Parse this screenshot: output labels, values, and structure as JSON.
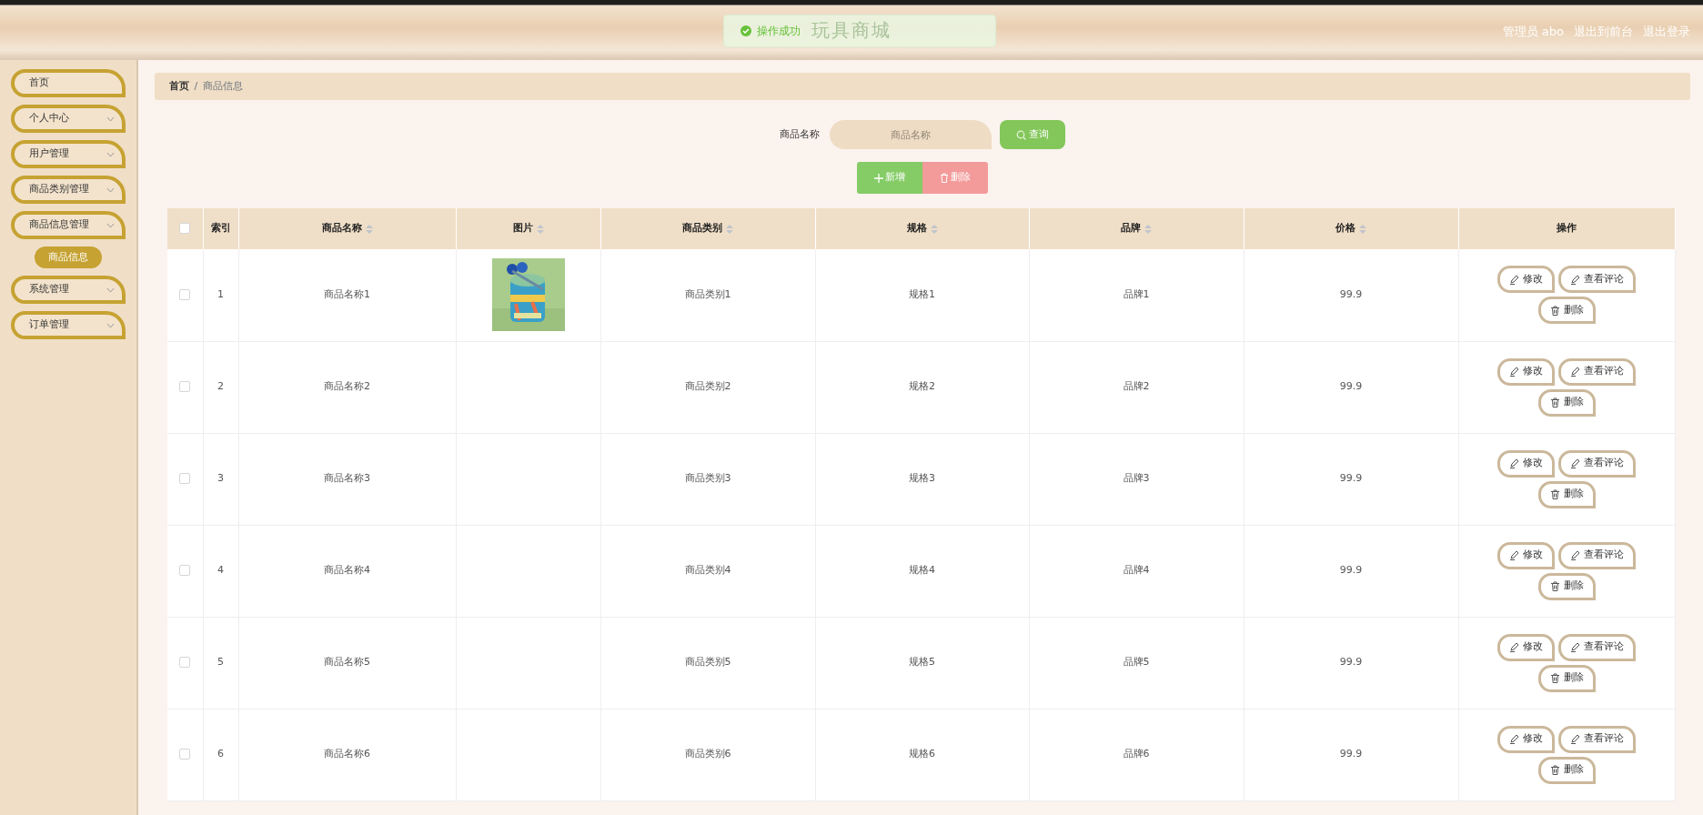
{
  "header": {
    "title": "玩具商城",
    "user": "管理员 abo",
    "links": [
      "退出到前台",
      "退出登录"
    ]
  },
  "toast": {
    "message": "操作成功"
  },
  "sidebar": {
    "items": [
      {
        "label": "首页",
        "kind": "link"
      },
      {
        "label": "个人中心",
        "kind": "group"
      },
      {
        "label": "用户管理",
        "kind": "group"
      },
      {
        "label": "商品类别管理",
        "kind": "group"
      },
      {
        "label": "商品信息管理",
        "kind": "group",
        "children": [
          {
            "label": "商品信息",
            "selected": true
          }
        ]
      },
      {
        "label": "系统管理",
        "kind": "group"
      },
      {
        "label": "订单管理",
        "kind": "group"
      }
    ]
  },
  "breadcrumb": {
    "items": [
      "首页",
      "商品信息"
    ],
    "separator": "/"
  },
  "search": {
    "label": "商品名称",
    "placeholder": "商品名称",
    "button": "查询"
  },
  "actions": {
    "add": "新增",
    "delete": "删除"
  },
  "table": {
    "columns": [
      {
        "label": "索引",
        "sortable": false
      },
      {
        "label": "商品名称",
        "sortable": true
      },
      {
        "label": "图片",
        "sortable": true
      },
      {
        "label": "商品类别",
        "sortable": true
      },
      {
        "label": "规格",
        "sortable": true
      },
      {
        "label": "品牌",
        "sortable": true
      },
      {
        "label": "价格",
        "sortable": true
      },
      {
        "label": "操作",
        "sortable": false
      }
    ],
    "select_all": {
      "checked": false
    },
    "rows": [
      {
        "checked": false,
        "index": "1",
        "name": "商品名称1",
        "has_picture": true,
        "category": "商品类别1",
        "spec": "规格1",
        "brand": "品牌1",
        "price": "99.9",
        "actions": [
          "修改",
          "查看评论",
          "删除"
        ]
      },
      {
        "checked": false,
        "index": "2",
        "name": "商品名称2",
        "has_picture": false,
        "category": "商品类别2",
        "spec": "规格2",
        "brand": "品牌2",
        "price": "99.9",
        "actions": [
          "修改",
          "查看评论",
          "删除"
        ]
      },
      {
        "checked": false,
        "index": "3",
        "name": "商品名称3",
        "has_picture": false,
        "category": "商品类别3",
        "spec": "规格3",
        "brand": "品牌3",
        "price": "99.9",
        "actions": [
          "修改",
          "查看评论",
          "删除"
        ]
      },
      {
        "checked": false,
        "index": "4",
        "name": "商品名称4",
        "has_picture": false,
        "category": "商品类别4",
        "spec": "规格4",
        "brand": "品牌4",
        "price": "99.9",
        "actions": [
          "修改",
          "查看评论",
          "删除"
        ]
      },
      {
        "checked": false,
        "index": "5",
        "name": "商品名称5",
        "has_picture": false,
        "category": "商品类别5",
        "spec": "规格5",
        "brand": "品牌5",
        "price": "99.9",
        "actions": [
          "修改",
          "查看评论",
          "删除"
        ]
      },
      {
        "checked": false,
        "index": "6",
        "name": "商品名称6",
        "has_picture": false,
        "category": "商品类别6",
        "spec": "规格6",
        "brand": "品牌6",
        "price": "99.9",
        "actions": [
          "修改",
          "查看评论",
          "删除"
        ]
      }
    ]
  }
}
